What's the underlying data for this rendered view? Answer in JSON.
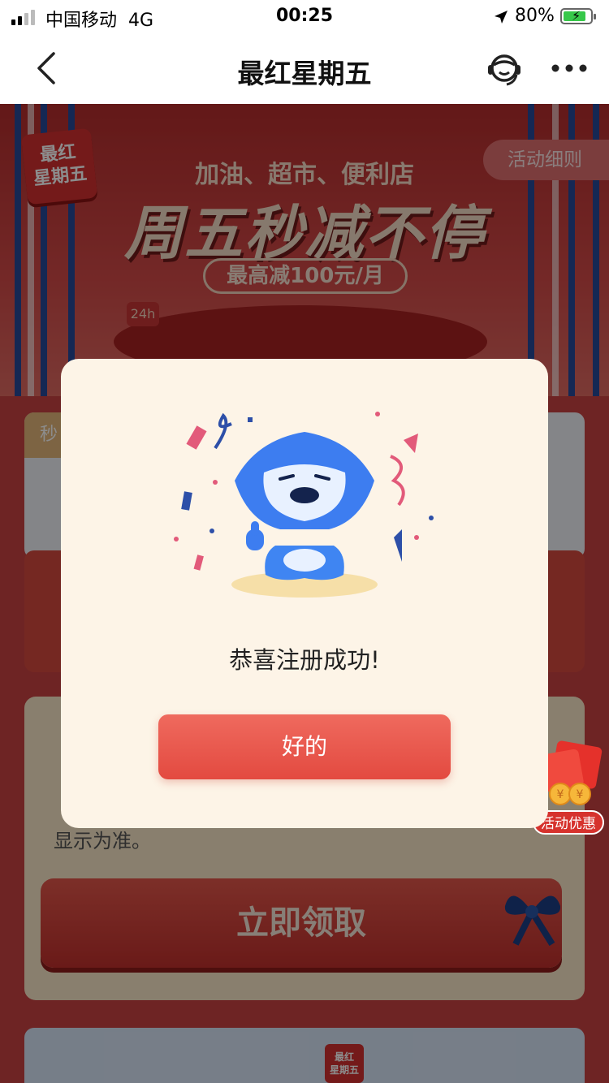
{
  "status_bar": {
    "carrier": "中国移动",
    "network": "4G",
    "time": "00:25",
    "battery": "80%"
  },
  "nav": {
    "title": "最红星期五",
    "back_icon": "chevron-left-icon",
    "service_icon": "customer-service-icon",
    "more_icon": "more-dots-icon"
  },
  "banner": {
    "logo_line1": "最红",
    "logo_line2": "星期五",
    "subtitle": "加油、超市、便利店",
    "headline": "周五秒减不停",
    "pill": "最高减100元/月",
    "rules_button": "活动细则",
    "box_label": "24h"
  },
  "cards": {
    "tag": "秒",
    "info_lines": [
      "显示为准。"
    ],
    "claim_button": "立即领取"
  },
  "promo": {
    "label": "活动优惠"
  },
  "dialog": {
    "message": "恭喜注册成功!",
    "ok_button": "好的"
  },
  "colors": {
    "accent_red": "#e34a40",
    "dialog_bg": "#fdf4e7",
    "mascot_blue": "#3d7df0"
  }
}
